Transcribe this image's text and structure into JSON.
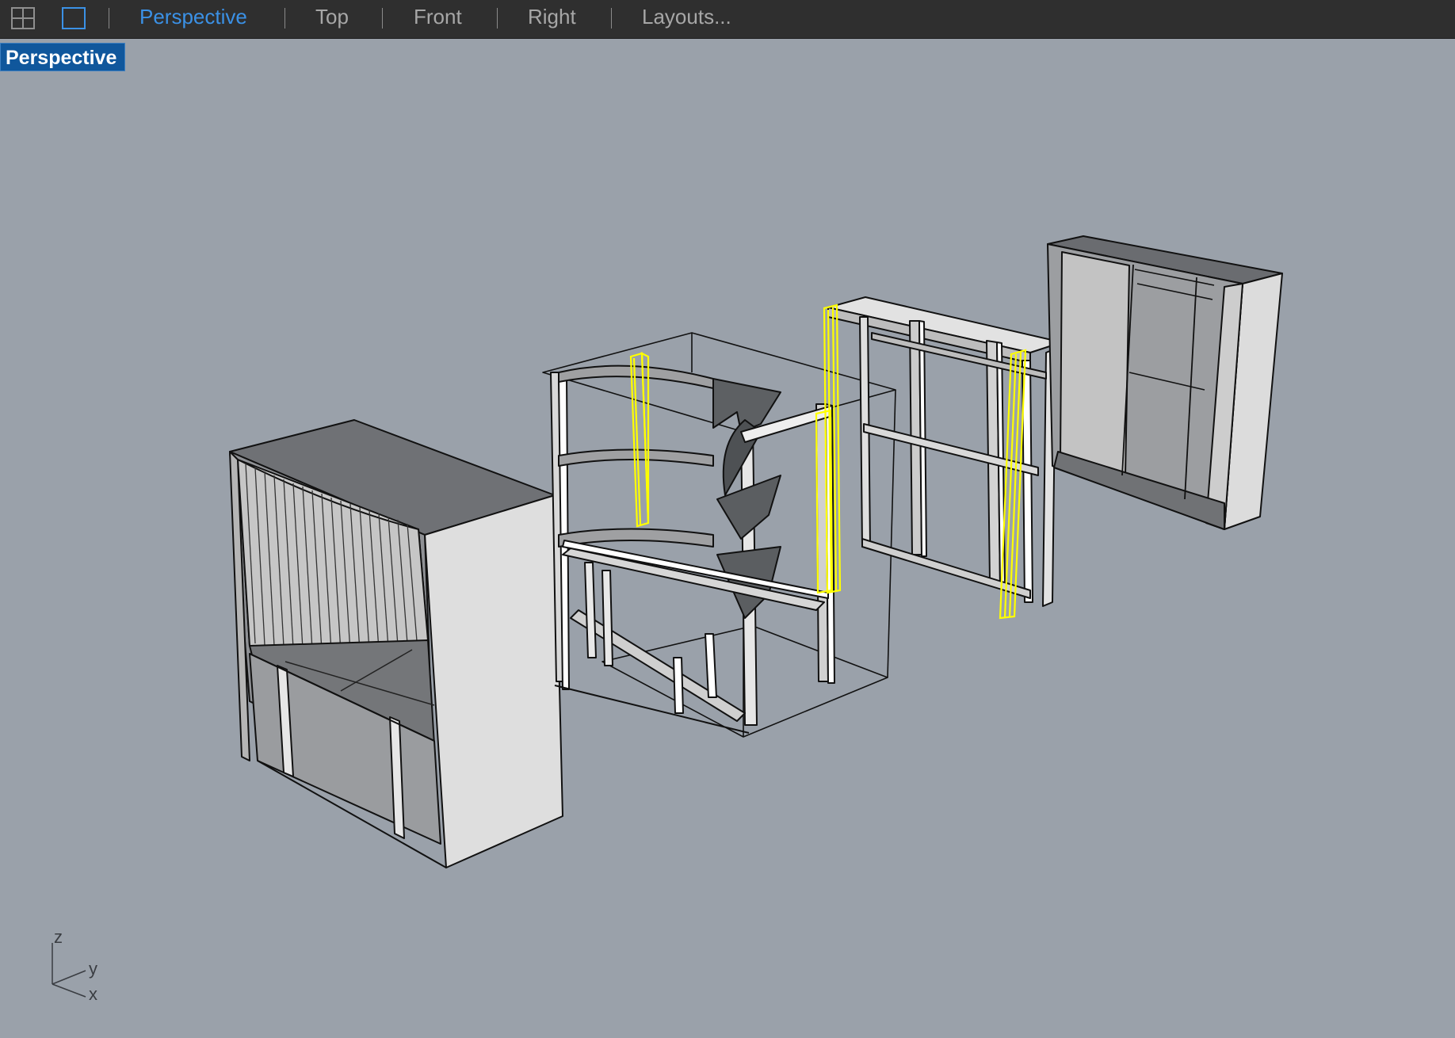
{
  "toolbar": {
    "tabs": [
      {
        "label": "Perspective",
        "active": true
      },
      {
        "label": "Top",
        "active": false
      },
      {
        "label": "Front",
        "active": false
      },
      {
        "label": "Right",
        "active": false
      },
      {
        "label": "Layouts...",
        "active": false
      }
    ],
    "icons": [
      "four-viewports-icon",
      "single-viewport-icon"
    ]
  },
  "viewport": {
    "title": "Perspective",
    "axis": {
      "z": "z",
      "y": "y",
      "x": "x"
    }
  },
  "colors": {
    "background": "#9aa1aa",
    "toolbar": "#2f2f2f",
    "active_tab": "#3b91e6",
    "viewport_title_bg": "#10579c",
    "selection": "#ffff00"
  }
}
